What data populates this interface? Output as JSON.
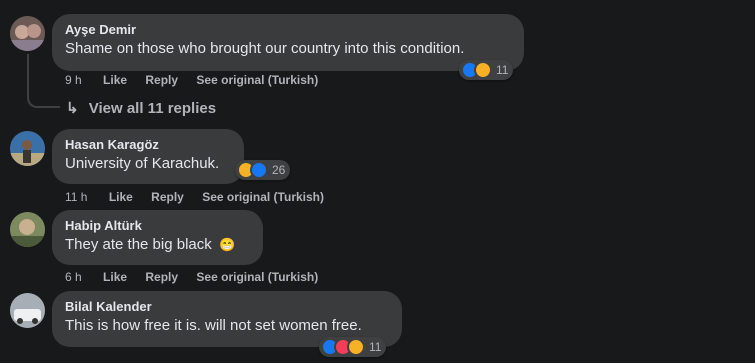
{
  "comments": [
    {
      "author": "Ayşe Demir",
      "text": "Shame on those who brought our country into this condition.",
      "time": "9 h",
      "like": "Like",
      "reply": "Reply",
      "see_original": "See original (Turkish)",
      "reaction_count": "11",
      "reactions": [
        "like",
        "haha"
      ]
    },
    {
      "author": "Hasan Karagöz",
      "text": "University of Karachuk.",
      "time": "11 h",
      "like": "Like",
      "reply": "Reply",
      "see_original": "See original (Turkish)",
      "reaction_count": "26",
      "reactions": [
        "haha",
        "like"
      ]
    },
    {
      "author": "Habip Altürk",
      "text": "They ate the big black",
      "emoji": "😁",
      "time": "6 h",
      "like": "Like",
      "reply": "Reply",
      "see_original": "See original (Turkish)"
    },
    {
      "author": "Bilal Kalender",
      "text": "This is how free it is. will not set women free.",
      "reaction_count": "11",
      "reactions": [
        "like",
        "love",
        "haha"
      ]
    }
  ],
  "view_replies": "View all 11 replies",
  "reply_arrow": "↳",
  "colors": {
    "background": "#18191a",
    "bubble": "#3a3b3c",
    "like": "#1877f2",
    "haha": "#f7b125",
    "love": "#f33e58"
  }
}
